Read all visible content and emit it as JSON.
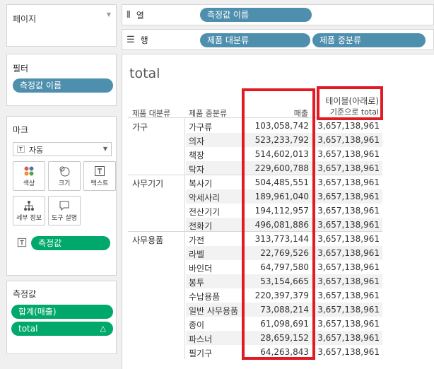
{
  "left": {
    "pages_title": "페이지",
    "filters_title": "필터",
    "filter_pill": "측정값 이름",
    "marks_title": "마크",
    "mark_type": "자동",
    "cards": [
      {
        "label": "색상",
        "icon": "color-icon"
      },
      {
        "label": "크기",
        "icon": "size-icon"
      },
      {
        "label": "텍스트",
        "icon": "text-icon"
      },
      {
        "label": "세부 정보",
        "icon": "detail-icon"
      },
      {
        "label": "도구 설명",
        "icon": "tooltip-icon"
      }
    ],
    "mark_pill": "측정값",
    "measures_title": "측정값",
    "measures": [
      "합계(매출)",
      "total"
    ],
    "delta_symbol": "△"
  },
  "shelves": {
    "columns_label": "열",
    "rows_label": "행",
    "columns_pills": [
      "측정값 이름"
    ],
    "rows_pills": [
      "제품 대분류",
      "제품 중분류"
    ]
  },
  "view": {
    "title": "total",
    "headers": {
      "cat": "제품 대분류",
      "sub": "제품 중분류",
      "sales": "매출",
      "total_line1": "테이블(아래로)",
      "total_line2": "기준으로 total"
    },
    "groups": [
      {
        "name": "가구",
        "rows": [
          {
            "sub": "가구류",
            "sales": "103,058,742",
            "total": "3,657,138,961"
          },
          {
            "sub": "의자",
            "sales": "523,233,792",
            "total": "3,657,138,961"
          },
          {
            "sub": "책장",
            "sales": "514,602,013",
            "total": "3,657,138,961"
          },
          {
            "sub": "탁자",
            "sales": "229,600,788",
            "total": "3,657,138,961"
          }
        ]
      },
      {
        "name": "사무기기",
        "rows": [
          {
            "sub": "복사기",
            "sales": "504,485,551",
            "total": "3,657,138,961"
          },
          {
            "sub": "악세사리",
            "sales": "189,961,040",
            "total": "3,657,138,961"
          },
          {
            "sub": "전산기기",
            "sales": "194,112,957",
            "total": "3,657,138,961"
          },
          {
            "sub": "전화기",
            "sales": "496,081,886",
            "total": "3,657,138,961"
          }
        ]
      },
      {
        "name": "사무용품",
        "rows": [
          {
            "sub": "가전",
            "sales": "313,773,144",
            "total": "3,657,138,961"
          },
          {
            "sub": "라벨",
            "sales": "22,769,526",
            "total": "3,657,138,961"
          },
          {
            "sub": "바인더",
            "sales": "64,797,580",
            "total": "3,657,138,961"
          },
          {
            "sub": "봉투",
            "sales": "53,154,665",
            "total": "3,657,138,961"
          },
          {
            "sub": "수납용품",
            "sales": "220,397,379",
            "total": "3,657,138,961"
          },
          {
            "sub": "일반 사무용품",
            "sales": "73,088,214",
            "total": "3,657,138,961"
          },
          {
            "sub": "종이",
            "sales": "61,098,691",
            "total": "3,657,138,961"
          },
          {
            "sub": "파스너",
            "sales": "28,659,152",
            "total": "3,657,138,961"
          },
          {
            "sub": "필기구",
            "sales": "64,263,843",
            "total": "3,657,138,961"
          }
        ]
      }
    ]
  },
  "colors": {
    "pill_blue": "#4f8fae",
    "pill_green": "#00a86b",
    "highlight_red": "#e01b24"
  }
}
